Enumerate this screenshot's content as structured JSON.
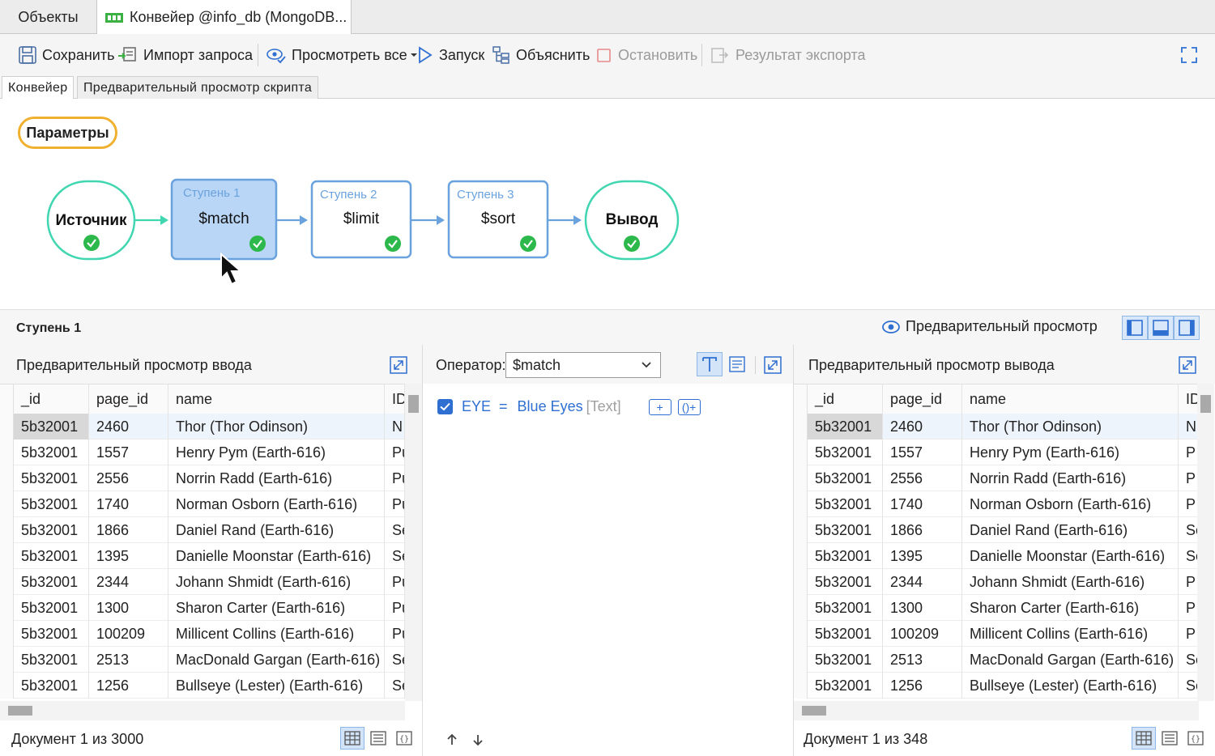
{
  "tabs": {
    "objects": "Объекты",
    "pipeline": "Конвейер @info_db (MongoDB..."
  },
  "toolbar": {
    "save": "Сохранить",
    "import": "Импорт запроса",
    "preview_all": "Просмотреть все",
    "run": "Запуск",
    "explain": "Объяснить",
    "stop": "Остановить",
    "export": "Результат экспорта"
  },
  "subtabs": {
    "pipeline": "Конвейер",
    "script": "Предварительный просмотр скрипта"
  },
  "canvas": {
    "params": "Параметры",
    "source": "Источник",
    "output": "Вывод",
    "stages": [
      {
        "caption": "Ступень 1",
        "op": "$match"
      },
      {
        "caption": "Ступень 2",
        "op": "$limit"
      },
      {
        "caption": "Ступень 3",
        "op": "$sort"
      }
    ]
  },
  "stage_bar": {
    "title": "Ступень 1",
    "preview": "Предварительный просмотр"
  },
  "input_panel": {
    "title": "Предварительный просмотр ввода",
    "doc_count": "Документ 1 из 3000"
  },
  "output_panel": {
    "title": "Предварительный просмотр вывода",
    "doc_count": "Документ 1 из 348"
  },
  "grid": {
    "columns": [
      "_id",
      "page_id",
      "name",
      "ID"
    ],
    "rows": [
      {
        "id": "5b32001",
        "page": "2460",
        "name": "Thor (Thor Odinson)",
        "idx": "N",
        "idx_r": "N"
      },
      {
        "id": "5b32001",
        "page": "1557",
        "name": "Henry Pym (Earth-616)",
        "idx": "Pu",
        "idx_r": "P"
      },
      {
        "id": "5b32001",
        "page": "2556",
        "name": "Norrin Radd (Earth-616)",
        "idx": "Pu",
        "idx_r": "P"
      },
      {
        "id": "5b32001",
        "page": "1740",
        "name": "Norman Osborn (Earth-616)",
        "idx": "Pu",
        "idx_r": "P"
      },
      {
        "id": "5b32001",
        "page": "1866",
        "name": "Daniel Rand (Earth-616)",
        "idx": "Se",
        "idx_r": "Se"
      },
      {
        "id": "5b32001",
        "page": "1395",
        "name": "Danielle Moonstar (Earth-616)",
        "idx": "Se",
        "idx_r": "Se"
      },
      {
        "id": "5b32001",
        "page": "2344",
        "name": "Johann Shmidt (Earth-616)",
        "idx": "Pu",
        "idx_r": "P"
      },
      {
        "id": "5b32001",
        "page": "1300",
        "name": "Sharon Carter (Earth-616)",
        "idx": "Pu",
        "idx_r": "P"
      },
      {
        "id": "5b32001",
        "page": "100209",
        "name": "Millicent Collins (Earth-616)",
        "idx": "Pu",
        "idx_r": "P"
      },
      {
        "id": "5b32001",
        "page": "2513",
        "name": "MacDonald Gargan (Earth-616)",
        "idx": "Se",
        "idx_r": "Se"
      },
      {
        "id": "5b32001",
        "page": "1256",
        "name": "Bullseye (Lester) (Earth-616)",
        "idx": "Se",
        "idx_r": "Se"
      }
    ]
  },
  "operator": {
    "label": "Оператор:",
    "value": "$match",
    "condition": {
      "field": "EYE",
      "op": "=",
      "value": "Blue Eyes",
      "type": "[Text]",
      "add": "+",
      "add_group": "()+"
    }
  },
  "colors": {
    "accent": "#2f6fd1",
    "node_green": "#3fd6b0",
    "node_blue": "#6aa2de",
    "params_border": "#f0b030",
    "check_green": "#2cb84a"
  }
}
